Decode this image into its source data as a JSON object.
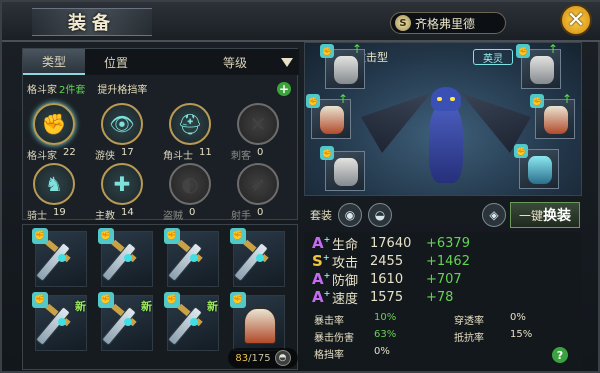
{
  "header": {
    "title": "装备",
    "hero_name": "齐格弗里德",
    "hero_badge": "S"
  },
  "tabs": {
    "type": "类型",
    "position": "位置",
    "level": "等级"
  },
  "filter": {
    "class_label": "格斗家",
    "sets": "2件套",
    "upgrade": "提升格挡率"
  },
  "classes": [
    {
      "label": "格斗家",
      "value": "22",
      "icon": "fist-icon",
      "glyph": "✊",
      "active": true,
      "selected": true
    },
    {
      "label": "游侠",
      "value": "17",
      "icon": "eye-icon",
      "glyph": "👁",
      "active": true,
      "selected": false
    },
    {
      "label": "角斗士",
      "value": "11",
      "icon": "helmet-icon",
      "glyph": "⛑",
      "active": true,
      "selected": false
    },
    {
      "label": "刺客",
      "value": "0",
      "icon": "crossed-blades-icon",
      "glyph": "✕",
      "active": false,
      "selected": false
    },
    {
      "label": "骑士",
      "value": "19",
      "icon": "horse-icon",
      "glyph": "♞",
      "active": true,
      "selected": false
    },
    {
      "label": "主教",
      "value": "14",
      "icon": "bishop-icon",
      "glyph": "✚",
      "active": true,
      "selected": false
    },
    {
      "label": "盗贼",
      "value": "0",
      "icon": "mask-icon",
      "glyph": "◐",
      "active": false,
      "selected": false
    },
    {
      "label": "射手",
      "value": "0",
      "icon": "bow-icon",
      "glyph": "➶",
      "active": false,
      "selected": false
    }
  ],
  "inventory": {
    "count": "83",
    "max": "175",
    "new_label": "新"
  },
  "hero": {
    "attack_type": "攻击型",
    "spirit": "英灵"
  },
  "suit": {
    "label": "套装",
    "swap_prefix": "一键",
    "swap_label": "换装"
  },
  "stats": [
    {
      "grade": "A",
      "name": "生命",
      "value": "17640",
      "bonus": "+6379"
    },
    {
      "grade": "S",
      "name": "攻击",
      "value": "2455",
      "bonus": "+1462"
    },
    {
      "grade": "A",
      "name": "防御",
      "value": "1610",
      "bonus": "+707"
    },
    {
      "grade": "A",
      "name": "速度",
      "value": "1575",
      "bonus": "+78"
    }
  ],
  "substats": {
    "crit_rate_label": "暴击率",
    "crit_rate": "10%",
    "penetration_label": "穿透率",
    "penetration": "0%",
    "crit_dmg_label": "暴击伤害",
    "crit_dmg": "63%",
    "resist_label": "抵抗率",
    "resist": "15%",
    "block_label": "格挡率",
    "block": "0%"
  },
  "colors": {
    "accent_teal": "#52c9c9",
    "bonus_green": "#66d255",
    "grade_a": "#c46cf0",
    "grade_s": "#f2c53a"
  }
}
